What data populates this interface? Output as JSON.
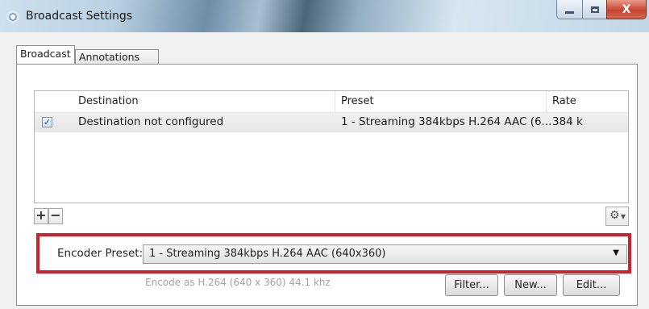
{
  "window": {
    "title": "Broadcast Settings",
    "close_glyph": "X"
  },
  "icons": {
    "app": "broadcast-app-icon",
    "gear": "gear-icon",
    "caret": "chevron-down-icon"
  },
  "tabs": [
    {
      "label": "Broadcast",
      "active": true
    },
    {
      "label": "Annotations",
      "active": false
    }
  ],
  "table": {
    "columns": [
      "Destination",
      "Preset",
      "Rate"
    ],
    "rows": [
      {
        "checked": true,
        "destination": "Destination not configured",
        "preset": "1 - Streaming 384kbps H.264 AAC (6...",
        "rate": "384 k"
      }
    ]
  },
  "list_controls": {
    "add_label": "+",
    "remove_label": "−"
  },
  "encoder": {
    "label": "Encoder Preset:",
    "selected": "1 - Streaming 384kbps H.264 AAC (640x360)",
    "description": "Encode as H.264 (640 x 360) 44.1 khz"
  },
  "buttons": {
    "filter": "Filter...",
    "new": "New...",
    "edit": "Edit..."
  },
  "colors": {
    "highlight": "#d0202a",
    "close_button": "#c7432f"
  }
}
